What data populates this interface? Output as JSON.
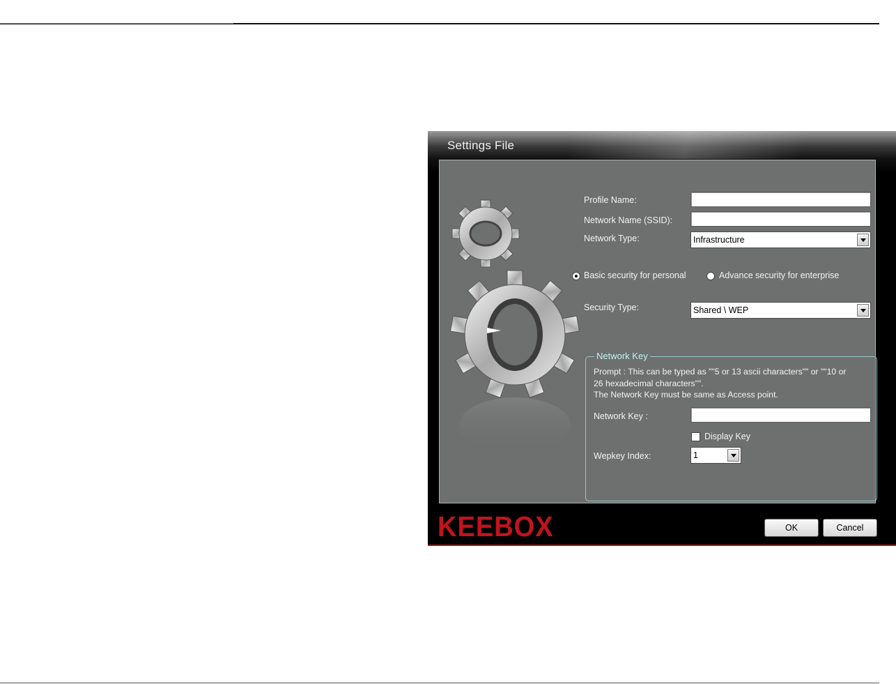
{
  "window": {
    "title": "Settings File"
  },
  "form": {
    "profile_name_label": "Profile Name:",
    "profile_name_value": "",
    "network_name_label": "Network Name (SSID):",
    "network_name_value": "",
    "network_type_label": "Network Type:",
    "network_type_value": "Infrastructure",
    "security_basic_label": "Basic security for personal",
    "security_advance_label": "Advance security for enterprise",
    "security_selected": "basic",
    "security_type_label": "Security Type:",
    "security_type_value": "Shared \\ WEP"
  },
  "network_key_group": {
    "legend": "Network Key",
    "prompt_line1": "Prompt : This can be typed as \"\"5 or 13 ascii characters\"\" or \"\"10 or",
    "prompt_line2": "26 hexadecimal characters\"\".",
    "prompt_line3": "The Network Key must be same as Access point.",
    "network_key_label": "Network Key :",
    "network_key_value": "",
    "display_key_label": "Display Key",
    "display_key_checked": false,
    "wepkey_index_label": "Wepkey Index:",
    "wepkey_index_value": "1"
  },
  "footer": {
    "logo_text": "KEEBOX",
    "ok_label": "OK",
    "cancel_label": "Cancel"
  },
  "colors": {
    "panel": "#6e706f",
    "logo_red": "#c0141c",
    "legend_cyan": "#bff4f0"
  }
}
